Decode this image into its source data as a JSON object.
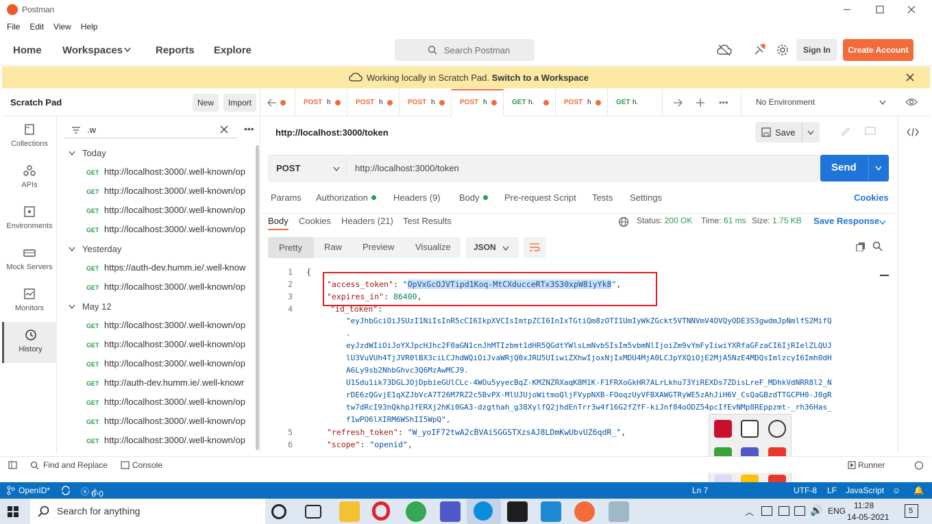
{
  "window": {
    "title": "Postman"
  },
  "menu": [
    "File",
    "Edit",
    "View",
    "Help"
  ],
  "nav": {
    "home": "Home",
    "workspaces": "Workspaces",
    "reports": "Reports",
    "explore": "Explore",
    "search_placeholder": "Search Postman",
    "sign_in": "Sign In",
    "create_account": "Create Account"
  },
  "banner": {
    "text": "Working locally in Scratch Pad.",
    "link": "Switch to a Workspace"
  },
  "scratch": {
    "title": "Scratch Pad",
    "new": "New",
    "import": "Import"
  },
  "leftnav": [
    "Collections",
    "APIs",
    "Environments",
    "Mock Servers",
    "Monitors",
    "History"
  ],
  "history": {
    "filter": ".w",
    "groups": [
      {
        "label": "Today",
        "items": [
          {
            "method": "GET",
            "url": "http://localhost:3000/.well-known/op"
          },
          {
            "method": "GET",
            "url": "http://localhost:3000/.well-known/op"
          },
          {
            "method": "GET",
            "url": "http://localhost:3000/.well-known/op"
          },
          {
            "method": "GET",
            "url": "http://localhost:3000/.well-known/op"
          }
        ]
      },
      {
        "label": "Yesterday",
        "items": [
          {
            "method": "GET",
            "url": "https://auth-dev.humm.ie/.well-know"
          },
          {
            "method": "GET",
            "url": "http://localhost:3000/.well-known/op"
          }
        ]
      },
      {
        "label": "May 12",
        "items": [
          {
            "method": "GET",
            "url": "http://localhost:3000/.well-known/op"
          },
          {
            "method": "GET",
            "url": "http://localhost:3000/.well-known/op"
          },
          {
            "method": "GET",
            "url": "http://localhost:3000/.well-known/op"
          },
          {
            "method": "GET",
            "url": "http://auth-dev.humm.ie/.well-knowr"
          },
          {
            "method": "GET",
            "url": "http://localhost:3000/.well-known/op"
          },
          {
            "method": "GET",
            "url": "http://localhost:3000/.well-known/op"
          },
          {
            "method": "GET",
            "url": "http://localhost:3000/.well-known/op"
          }
        ]
      }
    ]
  },
  "tabs": [
    {
      "method": "POST",
      "label": "h"
    },
    {
      "method": "POST",
      "label": "h"
    },
    {
      "method": "POST",
      "label": "h"
    },
    {
      "method": "POST",
      "label": "h"
    },
    {
      "method": "GET",
      "label": "h."
    },
    {
      "method": "POST",
      "label": "h"
    },
    {
      "method": "GET",
      "label": "h."
    }
  ],
  "environment": "No Environment",
  "request": {
    "url_title": "http://localhost:3000/token",
    "save": "Save",
    "method": "POST",
    "url": "http://localhost:3000/token",
    "send": "Send"
  },
  "req_tabs": {
    "params": "Params",
    "authorization": "Authorization",
    "headers": "Headers (9)",
    "body": "Body",
    "prerequest": "Pre-request Script",
    "tests": "Tests",
    "settings": "Settings",
    "cookies": "Cookies"
  },
  "resp_tabs": {
    "body": "Body",
    "cookies": "Cookies",
    "headers": "Headers (21)",
    "test_results": "Test Results",
    "status_label": "Status:",
    "status": "200 OK",
    "time_label": "Time:",
    "time": "61 ms",
    "size_label": "Size:",
    "size": "1.75 KB",
    "save_response": "Save Response"
  },
  "view_modes": {
    "pretty": "Pretty",
    "raw": "Raw",
    "preview": "Preview",
    "visualize": "Visualize",
    "format": "JSON"
  },
  "code": {
    "l1": "1",
    "l2": "2",
    "l3": "3",
    "l4": "4",
    "l5": "5",
    "l6": "6",
    "open": "{",
    "access_key": "\"access_token\"",
    "access_val": "OpVxGcOJVTipd1Koq-MtCXducceRTx3S30xpW8iyYk8",
    "expires_key": "\"expires_in\"",
    "expires_val": "86400",
    "id_key": "\"id_token\"",
    "id_lines": [
      "\"eyJhbGciOiJSUzI1NiIsInR5cCI6IkpXVCIsImtpZCI6InIxTGtiQm8zOTI1UmIyWkZGckt5VTNNVmV4OVQyODE3S3gwdmJpNmlfS2MifQ",
      ".",
      "eyJzdWIiOiJoYXJpcHJhc2F0aGN1cnJhMTIzbmt1dHR5QGdtYWlsLmNvbSIsIm5vbmNlIjoiZm9vYmFyIiwiYXRfaGFzaCI6IjRIelZLQUJ",
      "lU3VuVUh4TjJVR0lBX3ciLCJhdWQiOiJvaWRjQ0xJRU5UIiwiZXhwIjoxNjIxMDU4MjA0LCJpYXQiOjE2MjA5NzE4MDQsImlzcyI6Imh0dH",
      "A6Ly9sb2NhbGhvc3Q6MzAwMCJ9.",
      "U1Sdu1ik73DGLJOjDpbieGUlCLc-4WOu5yyecBqZ-KMZNZRXaqK8M1K-F1FRXoGkHR7ALrLkhu73YiREXDs7ZDisLreF_MDhkVdNRR8l2_N",
      "rDE6zQGvjE1qXZJbVcA7T26M7RZ2c5BvPX-MlUJUjoWitmoQljFVypNXB-FOoqzUyVFBXAWGTRyWE5zAhJiH6V_CsQaGBzdTTGCPH0-J0gR",
      "tw7dRcI93nQkhpJfERXj2hKi0GA3-dzgthah_g38XylfQ2jhdEnTrr3w4f16G2fZfF-kiJnf84oODZ54pcIfEvNMp8REppzmt-_rh36Has_",
      "f1wPO6lXIRM6WShII5WpQ\","
    ],
    "refresh_key": "\"refresh_token\"",
    "refresh_val": "\"W_yoIF72twA2cBVAiSGGSTXzsAJ8LDmKwUbvUZ6qdR_\"",
    "scope_key": "\"scope\"",
    "scope_val": "\"openid\""
  },
  "statusbar": {
    "find_replace": "Find and Replace",
    "console": "Console",
    "runner": "Runner"
  },
  "vscode": {
    "branch": "OpenID*",
    "errors": "0",
    "warnings": "0",
    "ln": "Ln 7",
    "encoding": "UTF-8",
    "eol": "LF",
    "lang": "JavaScript"
  },
  "taskbar": {
    "search": "Search for anything",
    "lang": "ENG",
    "time": "11:28",
    "date": "14-05-2021",
    "notif": "5"
  }
}
